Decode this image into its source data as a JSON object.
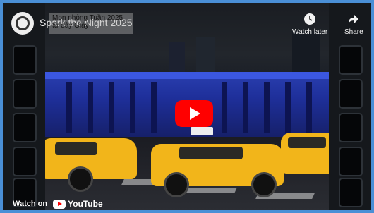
{
  "video": {
    "channel_title": "Spark the Night 2025",
    "caption_overlay": "Mon nhỏng Tuần 2025 từ đây Glây",
    "watch_later_label": "Watch later",
    "share_label": "Share",
    "watch_on_label": "Watch on",
    "youtube_label": "YouTube"
  },
  "icons": {
    "channel": "channel-avatar-icon",
    "watch_later": "clock-icon",
    "share": "share-arrow-icon",
    "play": "play-icon",
    "youtube": "youtube-logo-icon"
  },
  "colors": {
    "frame_border": "#4a8fd6",
    "play_button": "#ff0000",
    "taxi_yellow": "#f2b51a"
  }
}
